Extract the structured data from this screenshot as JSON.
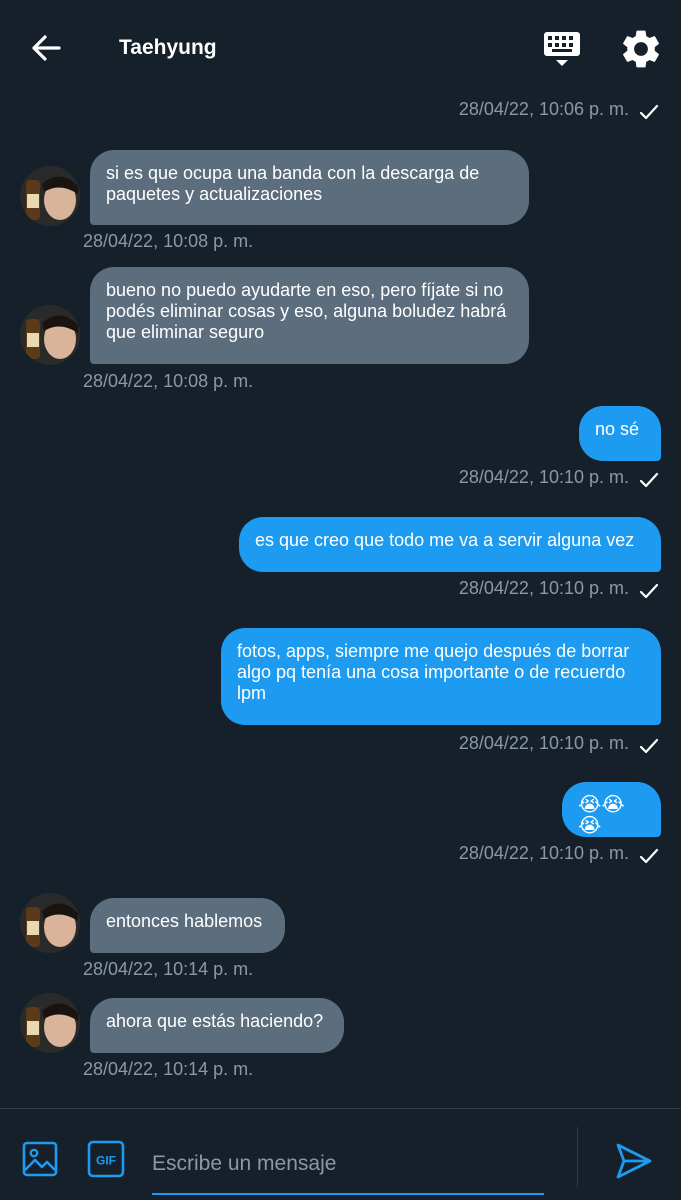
{
  "header": {
    "title": "Taehyung"
  },
  "colors": {
    "background": "#15202b",
    "incoming_bubble": "#5c6e7e",
    "outgoing_bubble": "#1d9bf0",
    "timestamp": "#8b98a5",
    "accent": "#1d9bf0"
  },
  "messages": [
    {
      "direction": "outgoing",
      "text": "",
      "timestamp": "28/04/22, 10:06 p. m.",
      "read": true
    },
    {
      "direction": "incoming",
      "text": "si es que ocupa una banda con la descarga de paquetes y actualizaciones",
      "timestamp": "28/04/22, 10:08 p. m."
    },
    {
      "direction": "incoming",
      "text": "bueno no puedo ayudarte en eso, pero fíjate si no podés eliminar cosas y eso, alguna boludez habrá que eliminar seguro",
      "timestamp": "28/04/22, 10:08 p. m."
    },
    {
      "direction": "outgoing",
      "text": "no sé",
      "timestamp": "28/04/22, 10:10 p. m.",
      "read": true
    },
    {
      "direction": "outgoing",
      "text": "es que creo que todo me va a servir alguna vez",
      "timestamp": "28/04/22, 10:10 p. m.",
      "read": true
    },
    {
      "direction": "outgoing",
      "text": "fotos, apps, siempre me quejo después de borrar algo pq tenía una cosa importante o de recuerdo lpm",
      "timestamp": "28/04/22, 10:10 p. m.",
      "read": true
    },
    {
      "direction": "outgoing",
      "text": "😭😭😭",
      "timestamp": "28/04/22, 10:10 p. m.",
      "read": true
    },
    {
      "direction": "incoming",
      "text": "entonces hablemos",
      "timestamp": "28/04/22, 10:14 p. m."
    },
    {
      "direction": "incoming",
      "text": "ahora que estás haciendo?",
      "timestamp": "28/04/22, 10:14 p. m."
    }
  ],
  "composer": {
    "placeholder": "Escribe un mensaje",
    "gif_label": "GIF"
  },
  "icons": {
    "back": "arrow-left-icon",
    "keyboard": "keyboard-icon",
    "settings": "gear-icon",
    "image": "image-icon",
    "gif": "gif-icon",
    "send": "send-icon",
    "read": "checkmark-icon"
  }
}
